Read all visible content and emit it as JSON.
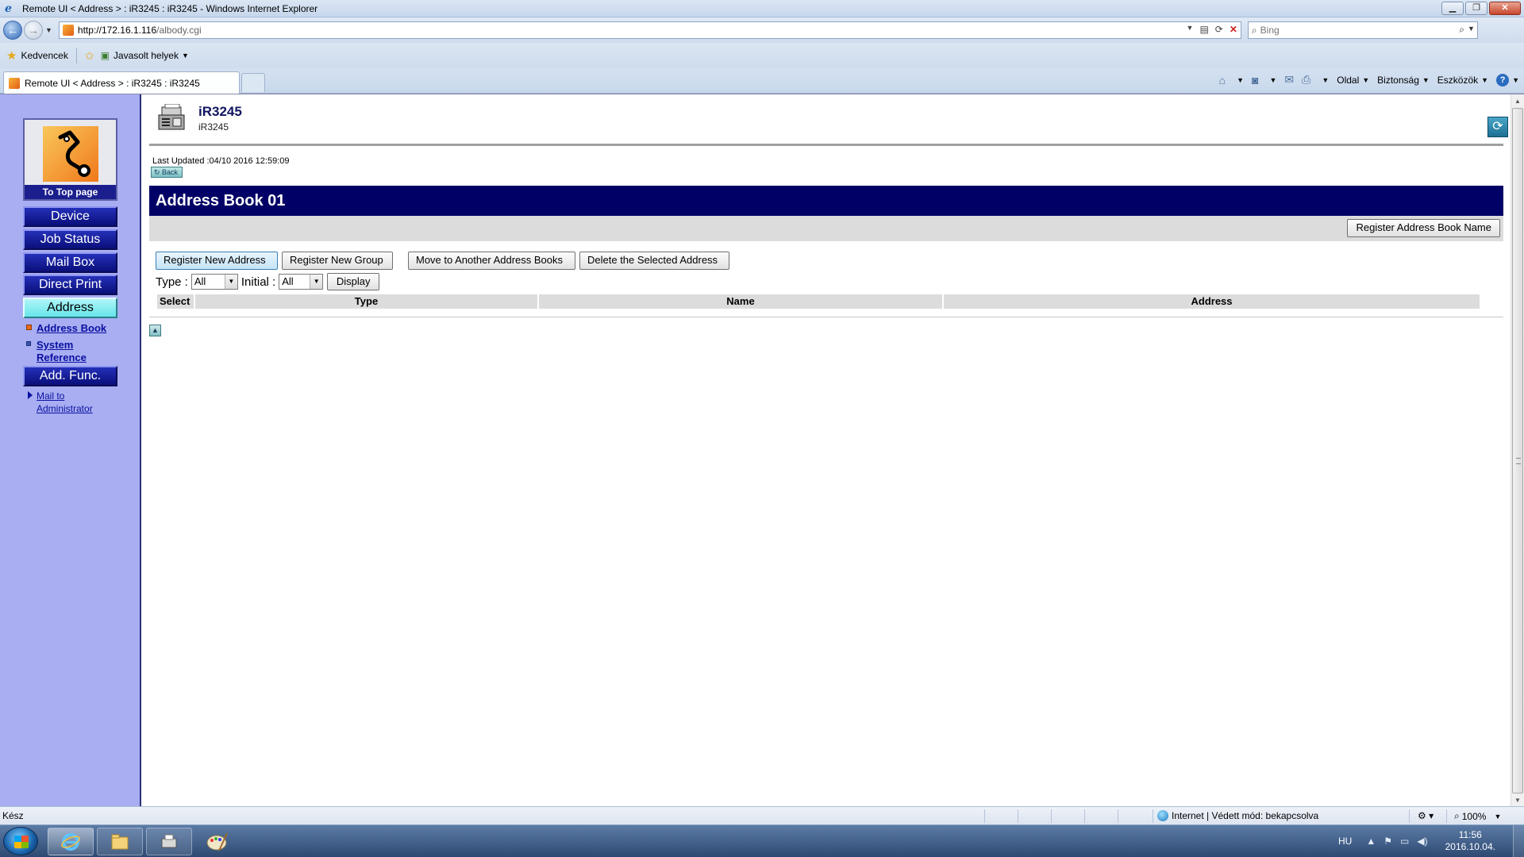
{
  "window": {
    "title": "Remote UI < Address > : iR3245 : iR3245 - Windows Internet Explorer",
    "minimize": "▁",
    "restore": "❐",
    "close": "✕"
  },
  "addressbar": {
    "url_host": "http://172.16.1.116",
    "url_path": "/albody.cgi",
    "search_placeholder": "Bing"
  },
  "favorites": {
    "label": "Kedvencek",
    "suggested": "Javasolt helyek"
  },
  "tab": {
    "title": "Remote UI < Address > : iR3245 : iR3245"
  },
  "commandbar": {
    "page": "Oldal",
    "safety": "Biztonság",
    "tools": "Eszközök"
  },
  "leftnav": {
    "top_page": "To Top page",
    "items": [
      {
        "label": "Device"
      },
      {
        "label": "Job Status"
      },
      {
        "label": "Mail Box"
      },
      {
        "label": "Direct Print"
      },
      {
        "label": "Address"
      },
      {
        "label": "Add. Func."
      }
    ],
    "sub": {
      "address_book": "Address Book",
      "system_reference_1": "System",
      "system_reference_2": "Reference",
      "mail_1": "Mail to",
      "mail_2": "Administrator"
    }
  },
  "device": {
    "name": "iR3245",
    "model": "iR3245",
    "last_updated": "Last Updated :04/10 2016 12:59:09",
    "back": "Back"
  },
  "section": {
    "title": "Address Book 01",
    "register_book_name": "Register Address Book Name"
  },
  "actions": {
    "register_address": "Register New Address",
    "register_group": "Register New Group",
    "move": "Move to Another Address Books",
    "delete": "Delete the Selected Address"
  },
  "filter": {
    "type_label": "Type :",
    "type_value": "All",
    "initial_label": "Initial :",
    "initial_value": "All",
    "display": "Display"
  },
  "table": {
    "headers": [
      "Select",
      "Type",
      "Name",
      "Address"
    ]
  },
  "status": {
    "text": "Kész",
    "zone": "Internet | Védett mód: bekapcsolva",
    "zoom": "100%"
  },
  "taskbar": {
    "lang": "HU",
    "time": "11:56",
    "date": "2016.10.04."
  }
}
